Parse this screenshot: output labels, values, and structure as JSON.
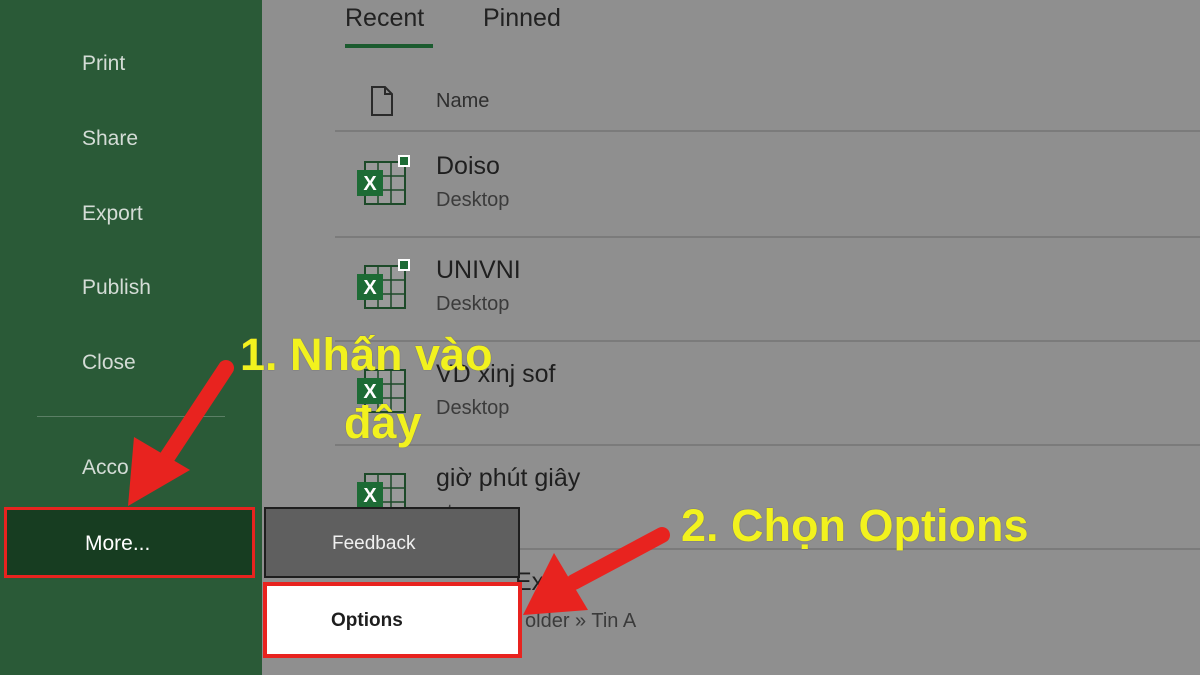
{
  "sidebar": {
    "items": [
      {
        "label": "Print"
      },
      {
        "label": "Share"
      },
      {
        "label": "Export"
      },
      {
        "label": "Publish"
      },
      {
        "label": "Close"
      },
      {
        "label": "Acco"
      },
      {
        "label": "More..."
      }
    ]
  },
  "tabs": [
    {
      "label": "Recent",
      "selected": true
    },
    {
      "label": "Pinned",
      "selected": false
    }
  ],
  "list": {
    "column_name": "Name",
    "files": [
      {
        "name": "Doiso",
        "location": "Desktop",
        "icon": "excel-file-icon"
      },
      {
        "name": "UNIVNI",
        "location": "Desktop",
        "icon": "excel-file-icon"
      },
      {
        "name": "VD xinj sof",
        "location": "Desktop",
        "icon": "excel-file-icon"
      },
      {
        "name": "giờ phút giây",
        "location": "nts",
        "icon": "excel-file-icon"
      },
      {
        "name": "Ex",
        "location": "older » Tin A",
        "icon": "excel-file-icon"
      }
    ]
  },
  "submenu": {
    "items": [
      {
        "label": "Feedback"
      },
      {
        "label": "Options"
      }
    ]
  },
  "annotations": {
    "step1": "1. Nhấn vào",
    "step1_cont": "đây",
    "step2": "2. Chọn Options"
  },
  "colors": {
    "sidebar": "#2a5a37",
    "highlight": "#e8231f",
    "annotation_text": "#f2f21e"
  }
}
